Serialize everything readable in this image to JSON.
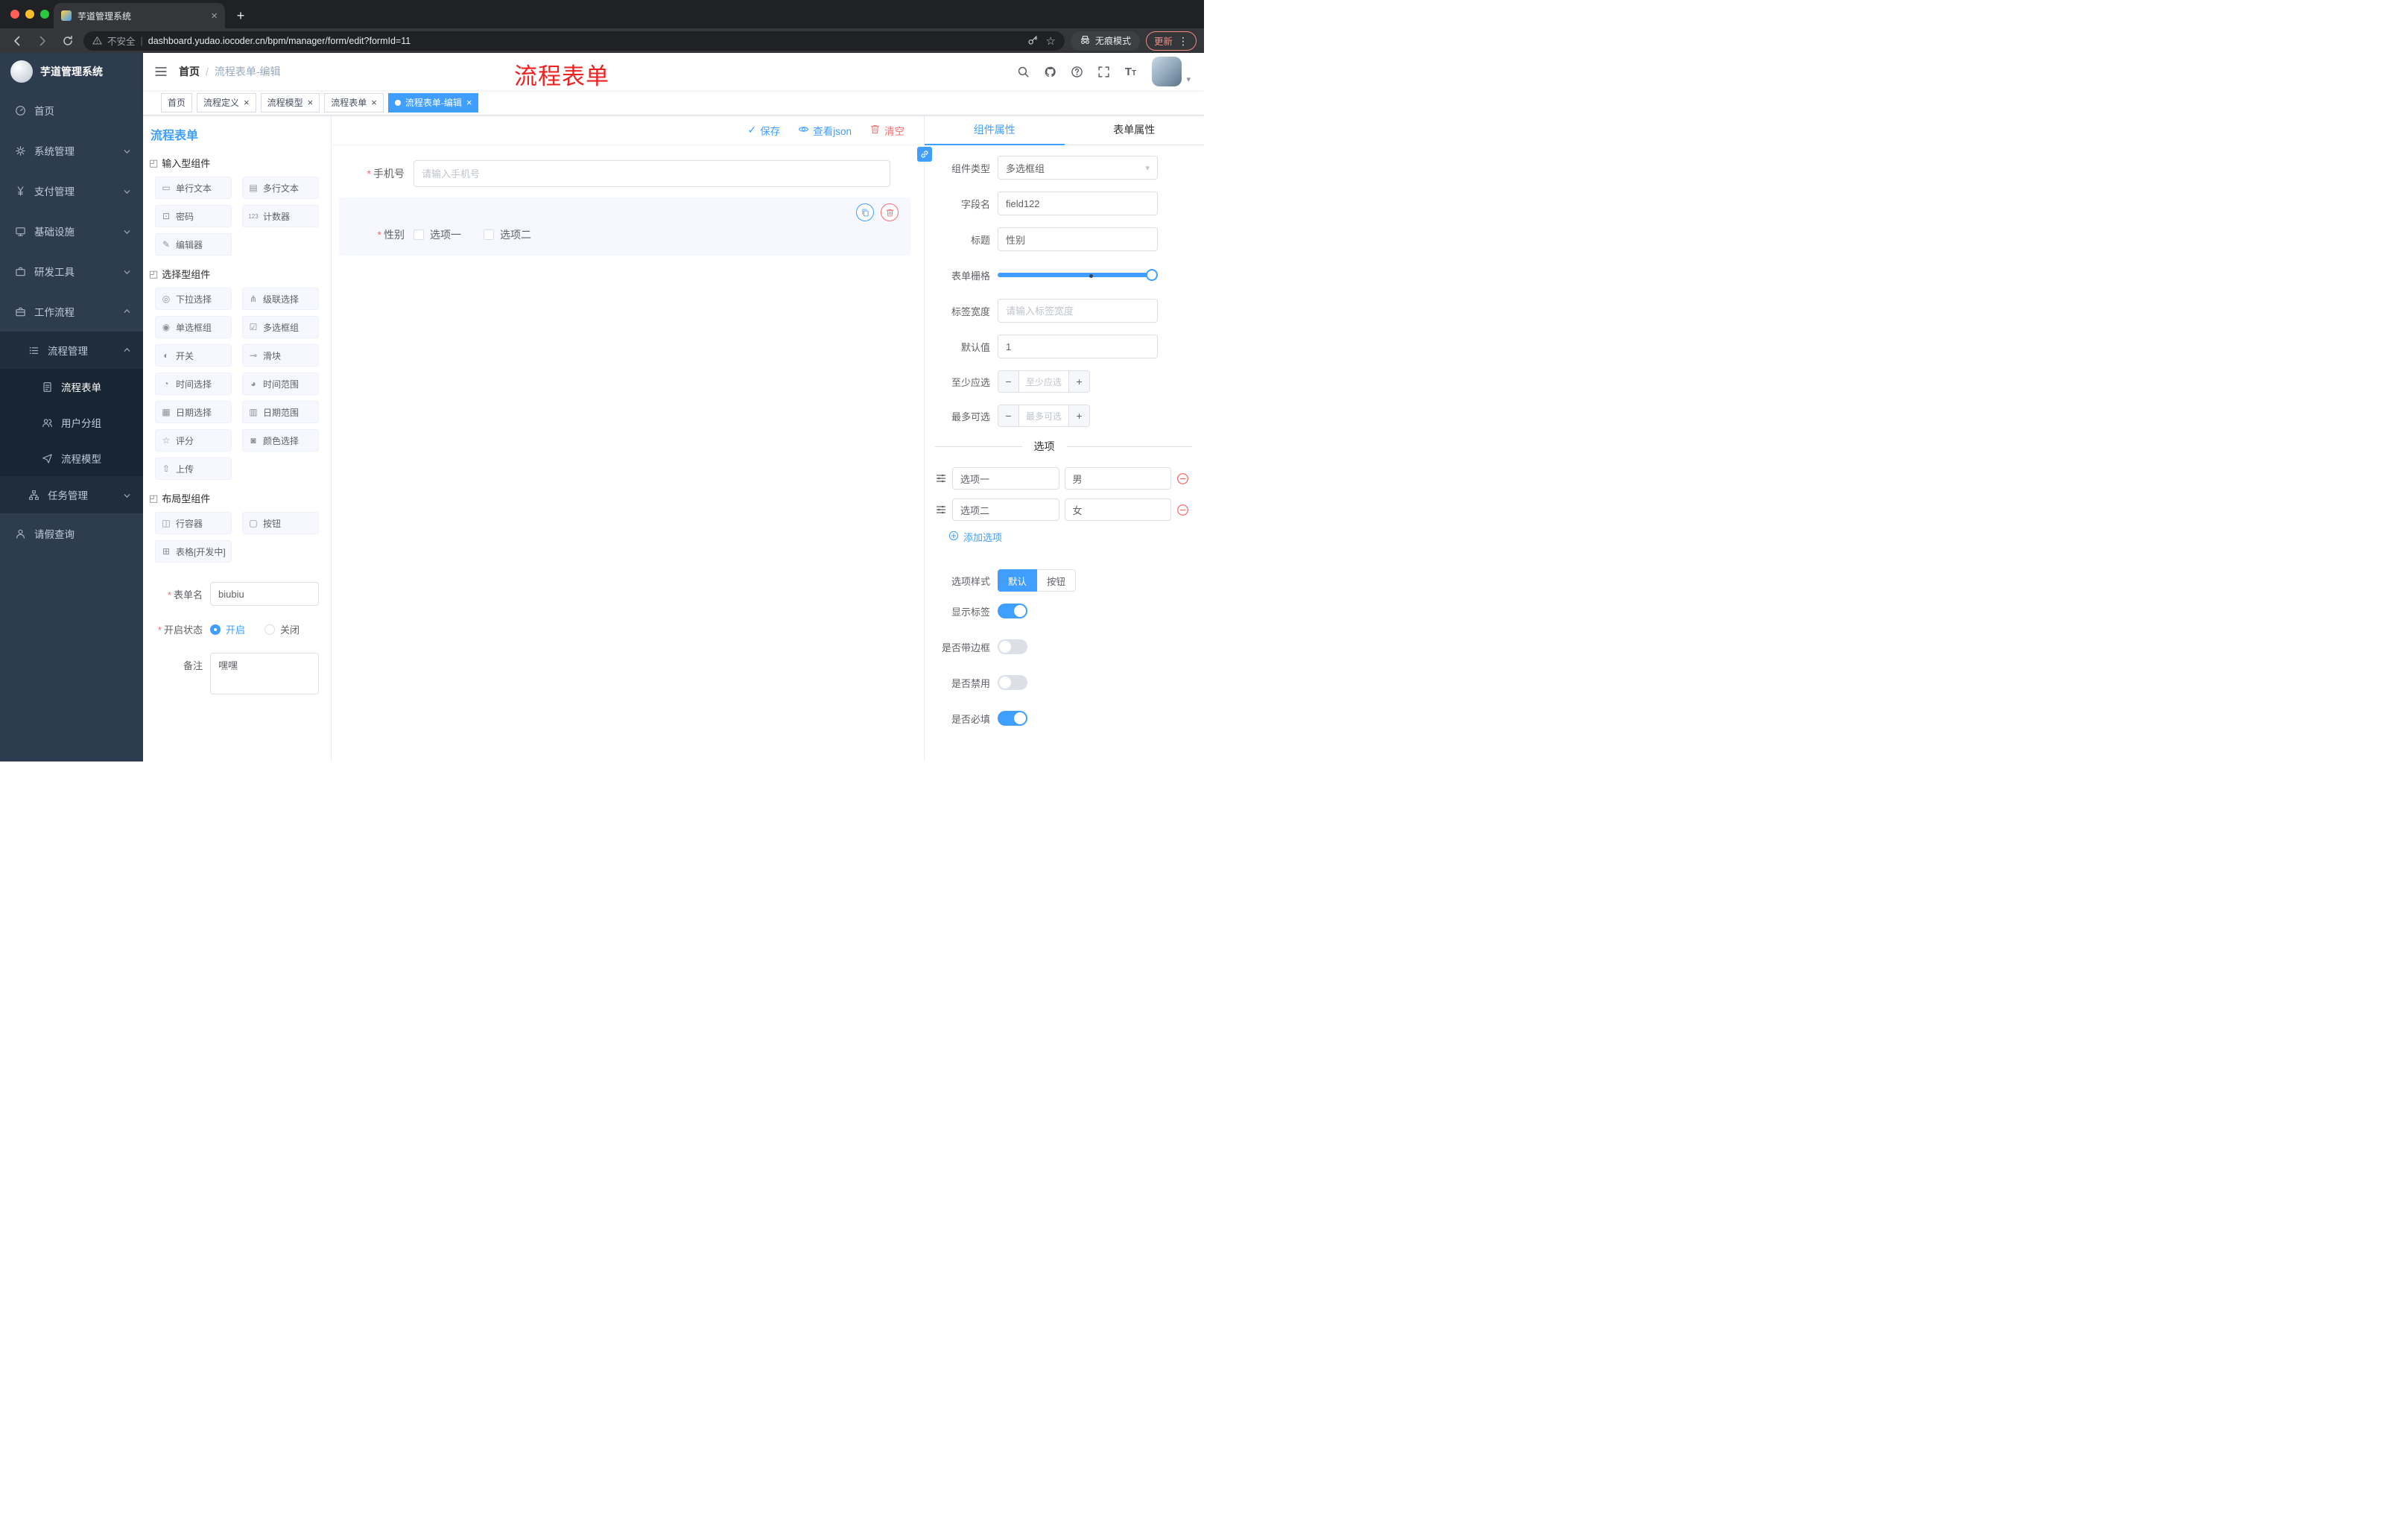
{
  "colors": {
    "primary": "#409EFF",
    "danger": "#F56C6C",
    "sidebar_bg": "#2E3C50",
    "annotation_red": "#EE2121",
    "active_tag_bg": "#409EFF"
  },
  "icons": {
    "close": "×",
    "new_tab": "+",
    "kebab": "⋮",
    "star": "☆",
    "caret_down": "▾",
    "check": "✓",
    "section": "◰",
    "required": "*",
    "breadcrumb_separator": "/",
    "font": "T"
  },
  "browser": {
    "tab_title": "芋道管理系统",
    "security_label": "不安全",
    "url": "dashboard.yudao.iocoder.cn/bpm/manager/form/edit?formId=11",
    "incognito_label": "无痕模式",
    "update_label": "更新"
  },
  "annotation": "流程表单",
  "sidebar": {
    "logo_title": "芋道管理系统",
    "menu": [
      {
        "label": "首页",
        "icon": "dashboard-icon"
      },
      {
        "label": "系统管理",
        "icon": "gear-icon"
      },
      {
        "label": "支付管理",
        "icon": "yen-icon"
      },
      {
        "label": "基础设施",
        "icon": "monitor-icon"
      },
      {
        "label": "研发工具",
        "icon": "briefcase-icon"
      },
      {
        "label": "工作流程",
        "icon": "workflow-icon"
      },
      {
        "label": "流程管理",
        "icon": "list-icon"
      },
      {
        "label": "流程表单",
        "icon": "document-icon"
      },
      {
        "label": "用户分组",
        "icon": "users-icon"
      },
      {
        "label": "流程模型",
        "icon": "send-icon"
      },
      {
        "label": "任务管理",
        "icon": "tree-icon"
      },
      {
        "label": "请假查询",
        "icon": "person-icon"
      }
    ]
  },
  "header": {
    "breadcrumb": [
      "首页",
      "流程表单-编辑"
    ]
  },
  "tags": [
    {
      "label": "首页",
      "closable": false,
      "active": false
    },
    {
      "label": "流程定义",
      "closable": true,
      "active": false
    },
    {
      "label": "流程模型",
      "closable": true,
      "active": false
    },
    {
      "label": "流程表单",
      "closable": true,
      "active": false
    },
    {
      "label": "流程表单-编辑",
      "closable": true,
      "active": true
    }
  ],
  "designer": {
    "title": "流程表单",
    "toolbar": {
      "save": "保存",
      "view_json": "查看json",
      "clear": "清空"
    }
  },
  "palette": {
    "sections": [
      {
        "title": "输入型组件",
        "items": [
          {
            "label": "单行文本",
            "icon": "▭"
          },
          {
            "label": "多行文本",
            "icon": "▤"
          },
          {
            "label": "密码",
            "icon": "⊡"
          },
          {
            "label": "计数器",
            "icon": "123"
          },
          {
            "label": "编辑器",
            "icon": "✎"
          }
        ]
      },
      {
        "title": "选择型组件",
        "items": [
          {
            "label": "下拉选择",
            "icon": "◎"
          },
          {
            "label": "级联选择",
            "icon": "⋔"
          },
          {
            "label": "单选框组",
            "icon": "◉"
          },
          {
            "label": "多选框组",
            "icon": "☑"
          },
          {
            "label": "开关",
            "icon": "◐"
          },
          {
            "label": "滑块",
            "icon": "⊸"
          },
          {
            "label": "时间选择",
            "icon": "◔"
          },
          {
            "label": "时间范围",
            "icon": "◕"
          },
          {
            "label": "日期选择",
            "icon": "▦"
          },
          {
            "label": "日期范围",
            "icon": "▥"
          },
          {
            "label": "评分",
            "icon": "☆"
          },
          {
            "label": "颜色选择",
            "icon": "◙"
          },
          {
            "label": "上传",
            "icon": "⇧"
          }
        ]
      },
      {
        "title": "布局型组件",
        "items": [
          {
            "label": "行容器",
            "icon": "◫"
          },
          {
            "label": "按钮",
            "icon": "▢"
          },
          {
            "label": "表格[开发中]",
            "icon": "⊞"
          }
        ]
      }
    ],
    "meta_form": {
      "name_label": "表单名",
      "name_value": "biubiu",
      "status_label": "开启状态",
      "status_options": [
        "开启",
        "关闭"
      ],
      "status_selected": "开启",
      "remark_label": "备注",
      "remark_value": "嘿嘿"
    }
  },
  "canvas": {
    "phone": {
      "label": "手机号",
      "placeholder": "请输入手机号"
    },
    "gender": {
      "label": "性别",
      "options": [
        "选项一",
        "选项二"
      ]
    }
  },
  "props": {
    "tabs": [
      "组件属性",
      "表单属性"
    ],
    "active_tab": "组件属性",
    "fields": {
      "component_type": {
        "label": "组件类型",
        "value": "多选框组"
      },
      "field_name": {
        "label": "字段名",
        "value": "field122"
      },
      "title": {
        "label": "标题",
        "value": "性别"
      },
      "grid": {
        "label": "表单栅格"
      },
      "label_width": {
        "label": "标签宽度",
        "placeholder": "请输入标签宽度"
      },
      "default_value": {
        "label": "默认值",
        "value": "1"
      },
      "min_select": {
        "label": "至少应选",
        "placeholder": "至少应选"
      },
      "max_select": {
        "label": "最多可选",
        "placeholder": "最多可选"
      }
    },
    "options_section": {
      "divider": "选项",
      "rows": [
        {
          "name": "选项一",
          "value": "男"
        },
        {
          "name": "选项二",
          "value": "女"
        }
      ],
      "add_label": "添加选项"
    },
    "option_style": {
      "label": "选项样式",
      "options": [
        "默认",
        "按钮"
      ],
      "selected": "默认"
    },
    "switches": [
      {
        "label": "显示标签",
        "on": true
      },
      {
        "label": "是否带边框",
        "on": false
      },
      {
        "label": "是否禁用",
        "on": false
      },
      {
        "label": "是否必填",
        "on": true
      }
    ]
  }
}
